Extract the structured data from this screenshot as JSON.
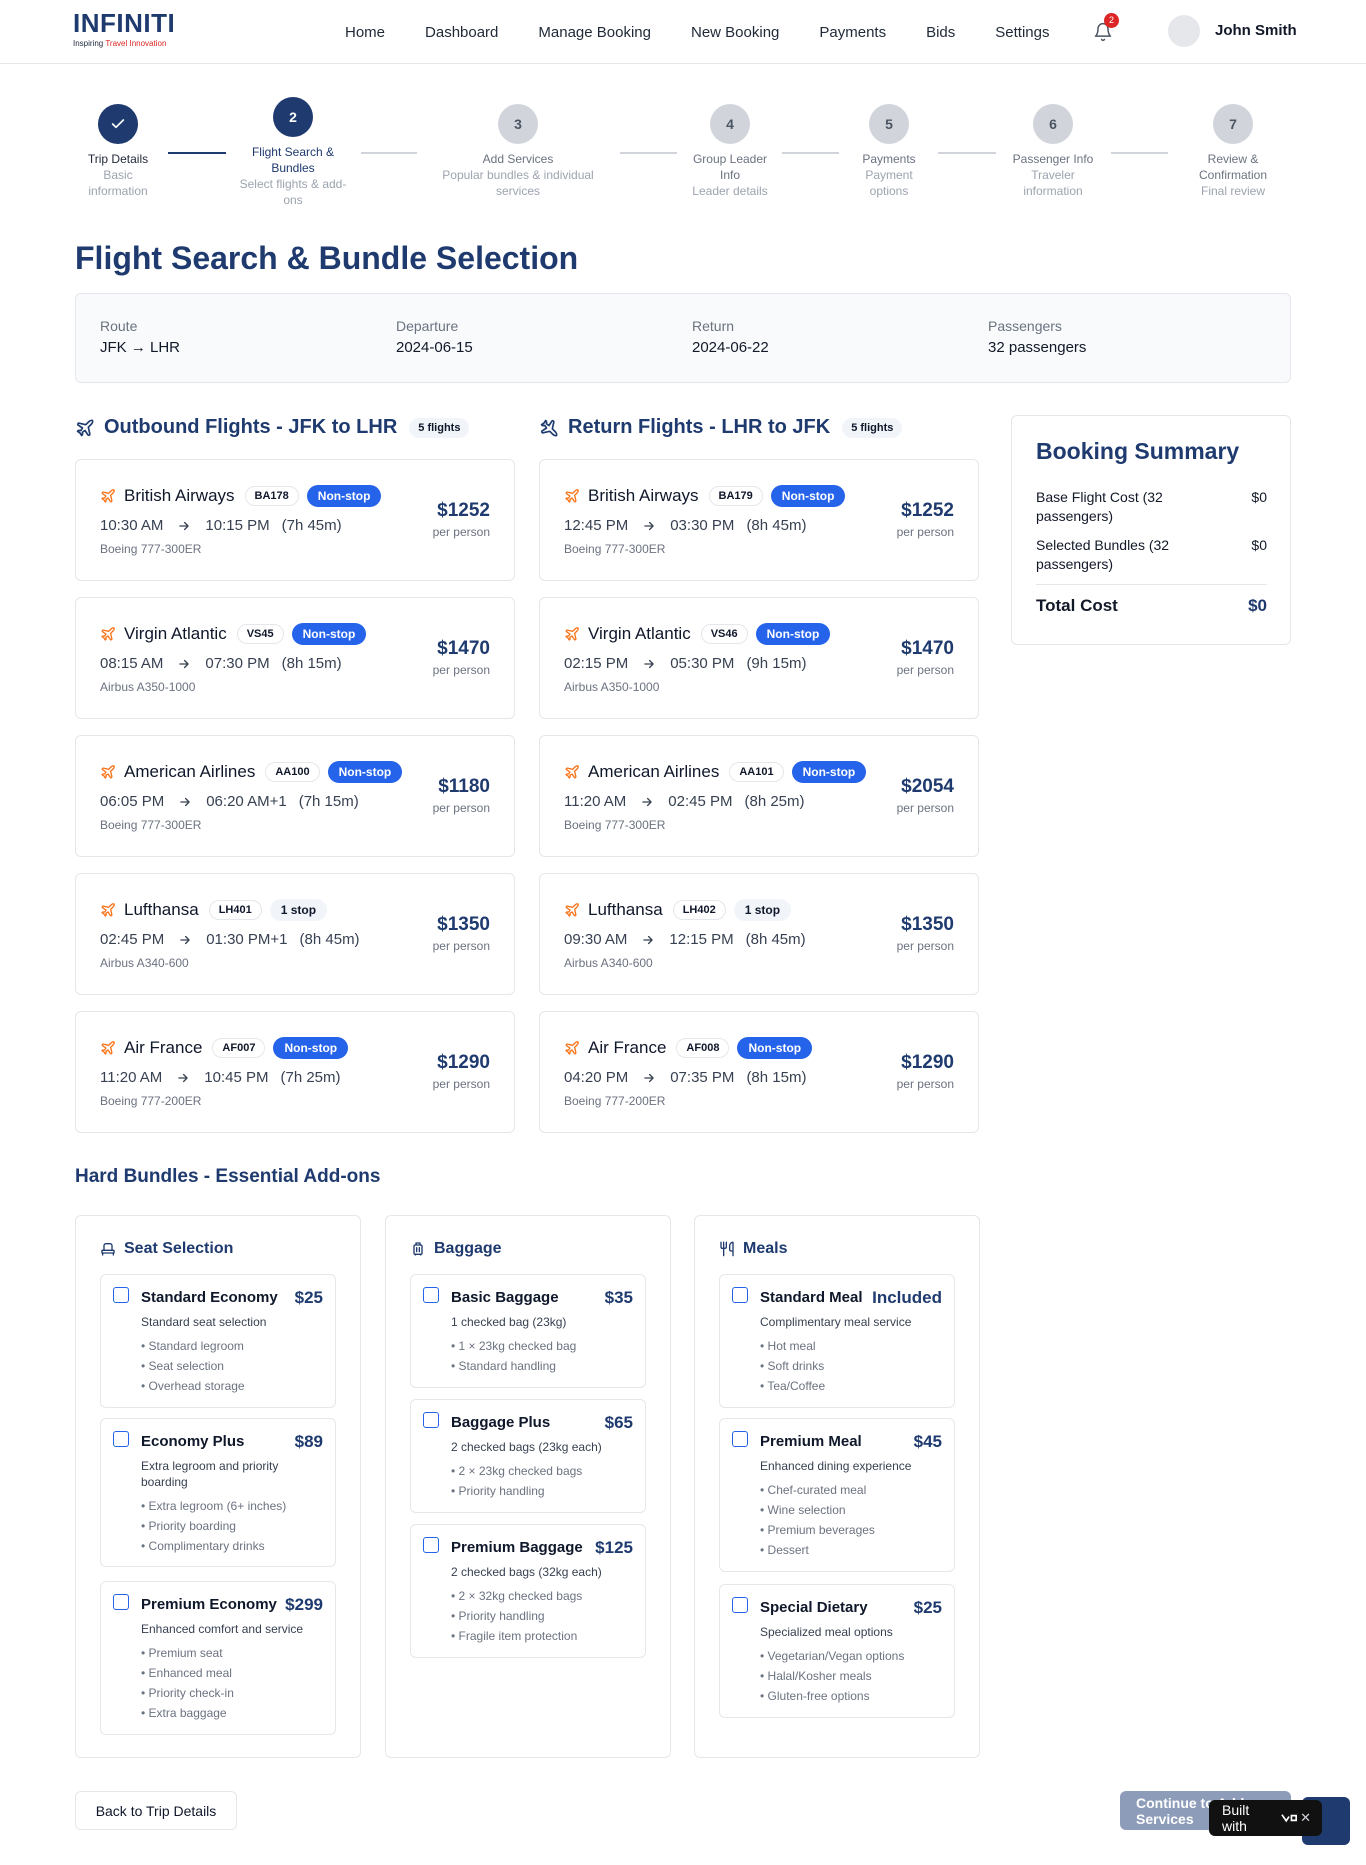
{
  "brand": {
    "name": "INFINITI",
    "tagline_start": "Inspiring ",
    "tagline_accent": "Travel Innovation"
  },
  "nav": {
    "links": [
      "Home",
      "Dashboard",
      "Manage Booking",
      "New Booking",
      "Payments",
      "Bids",
      "Settings"
    ],
    "notifications": "2",
    "user": "John Smith"
  },
  "steps": [
    {
      "num": "",
      "title": "Trip Details",
      "sub": "Basic information",
      "state": "done"
    },
    {
      "num": "2",
      "title": "Flight Search & Bundles",
      "sub": "Select flights & add-ons",
      "state": "active"
    },
    {
      "num": "3",
      "title": "Add Services",
      "sub": "Popular bundles & individual services",
      "state": "todo"
    },
    {
      "num": "4",
      "title": "Group Leader Info",
      "sub": "Leader details",
      "state": "todo"
    },
    {
      "num": "5",
      "title": "Payments",
      "sub": "Payment options",
      "state": "todo"
    },
    {
      "num": "6",
      "title": "Passenger Info",
      "sub": "Traveler information",
      "state": "todo"
    },
    {
      "num": "7",
      "title": "Review & Confirmation",
      "sub": "Final review",
      "state": "todo"
    }
  ],
  "page": {
    "title": "Flight Search & Bundle Selection"
  },
  "route": {
    "route_label": "Route",
    "route_value": "JFK → LHR",
    "departure_label": "Departure",
    "departure_value": "2024-06-15",
    "return_label": "Return",
    "return_value": "2024-06-22",
    "passengers_label": "Passengers",
    "passengers_value": "32 passengers"
  },
  "outbound": {
    "title": "Outbound Flights - JFK to LHR",
    "count": "5 flights",
    "flights": [
      {
        "airline": "British Airways",
        "code": "BA178",
        "type": "Non-stop",
        "dep": "10:30 AM",
        "arr": "10:15 PM",
        "dur": "(7h 45m)",
        "aircraft": "Boeing 777-300ER",
        "price": "$1252",
        "per": "per person"
      },
      {
        "airline": "Virgin Atlantic",
        "code": "VS45",
        "type": "Non-stop",
        "dep": "08:15 AM",
        "arr": "07:30 PM",
        "dur": "(8h 15m)",
        "aircraft": "Airbus A350-1000",
        "price": "$1470",
        "per": "per person"
      },
      {
        "airline": "American Airlines",
        "code": "AA100",
        "type": "Non-stop",
        "dep": "06:05 PM",
        "arr": "06:20 AM+1",
        "dur": "(7h 15m)",
        "aircraft": "Boeing 777-300ER",
        "price": "$1180",
        "per": "per person"
      },
      {
        "airline": "Lufthansa",
        "code": "LH401",
        "type": "1 stop",
        "dep": "02:45 PM",
        "arr": "01:30 PM+1",
        "dur": "(8h 45m)",
        "aircraft": "Airbus A340-600",
        "price": "$1350",
        "per": "per person"
      },
      {
        "airline": "Air France",
        "code": "AF007",
        "type": "Non-stop",
        "dep": "11:20 AM",
        "arr": "10:45 PM",
        "dur": "(7h 25m)",
        "aircraft": "Boeing 777-200ER",
        "price": "$1290",
        "per": "per person"
      }
    ]
  },
  "return": {
    "title": "Return Flights - LHR to JFK",
    "count": "5 flights",
    "flights": [
      {
        "airline": "British Airways",
        "code": "BA179",
        "type": "Non-stop",
        "dep": "12:45 PM",
        "arr": "03:30 PM",
        "dur": "(8h 45m)",
        "aircraft": "Boeing 777-300ER",
        "price": "$1252",
        "per": "per person"
      },
      {
        "airline": "Virgin Atlantic",
        "code": "VS46",
        "type": "Non-stop",
        "dep": "02:15 PM",
        "arr": "05:30 PM",
        "dur": "(9h 15m)",
        "aircraft": "Airbus A350-1000",
        "price": "$1470",
        "per": "per person"
      },
      {
        "airline": "American Airlines",
        "code": "AA101",
        "type": "Non-stop",
        "dep": "11:20 AM",
        "arr": "02:45 PM",
        "dur": "(8h 25m)",
        "aircraft": "Boeing 777-300ER",
        "price": "$2054",
        "per": "per person"
      },
      {
        "airline": "Lufthansa",
        "code": "LH402",
        "type": "1 stop",
        "dep": "09:30 AM",
        "arr": "12:15 PM",
        "dur": "(8h 45m)",
        "aircraft": "Airbus A340-600",
        "price": "$1350",
        "per": "per person"
      },
      {
        "airline": "Air France",
        "code": "AF008",
        "type": "Non-stop",
        "dep": "04:20 PM",
        "arr": "07:35 PM",
        "dur": "(8h 15m)",
        "aircraft": "Boeing 777-200ER",
        "price": "$1290",
        "per": "per person"
      }
    ]
  },
  "summary": {
    "title": "Booking Summary",
    "base_label": "Base Flight Cost (32 passengers)",
    "base_value": "$0",
    "bundles_label": "Selected Bundles (32 passengers)",
    "bundles_value": "$0",
    "total_label": "Total Cost",
    "total_value": "$0"
  },
  "bundles": {
    "title": "Hard Bundles - Essential Add-ons",
    "columns": [
      {
        "title": "Seat Selection",
        "icon": "seat-icon",
        "items": [
          {
            "name": "Standard Economy",
            "price": "$25",
            "desc": "Standard seat selection",
            "features": [
              "• Standard legroom",
              "• Seat selection",
              "• Overhead storage"
            ]
          },
          {
            "name": "Economy Plus",
            "price": "$89",
            "desc": "Extra legroom and priority boarding",
            "features": [
              "• Extra legroom (6+ inches)",
              "• Priority boarding",
              "• Complimentary drinks"
            ]
          },
          {
            "name": "Premium Economy",
            "price": "$299",
            "desc": "Enhanced comfort and service",
            "features": [
              "• Premium seat",
              "• Enhanced meal",
              "• Priority check-in",
              "• Extra baggage"
            ]
          }
        ]
      },
      {
        "title": "Baggage",
        "icon": "luggage-icon",
        "items": [
          {
            "name": "Basic Baggage",
            "price": "$35",
            "desc": "1 checked bag (23kg)",
            "features": [
              "• 1 × 23kg checked bag",
              "• Standard handling"
            ]
          },
          {
            "name": "Baggage Plus",
            "price": "$65",
            "desc": "2 checked bags (23kg each)",
            "features": [
              "• 2 × 23kg checked bags",
              "• Priority handling"
            ]
          },
          {
            "name": "Premium Baggage",
            "price": "$125",
            "desc": "2 checked bags (32kg each)",
            "features": [
              "• 2 × 32kg checked bags",
              "• Priority handling",
              "• Fragile item protection"
            ]
          }
        ]
      },
      {
        "title": "Meals",
        "icon": "utensils-icon",
        "items": [
          {
            "name": "Standard Meal",
            "price": "Included",
            "desc": "Complimentary meal service",
            "features": [
              "• Hot meal",
              "• Soft drinks",
              "• Tea/Coffee"
            ]
          },
          {
            "name": "Premium Meal",
            "price": "$45",
            "desc": "Enhanced dining experience",
            "features": [
              "• Chef-curated meal",
              "• Wine selection",
              "• Premium beverages",
              "• Dessert"
            ]
          },
          {
            "name": "Special Dietary",
            "price": "$25",
            "desc": "Specialized meal options",
            "features": [
              "• Vegetarian/Vegan options",
              "• Halal/Kosher meals",
              "• Gluten-free options"
            ]
          }
        ]
      }
    ]
  },
  "footer": {
    "back": "Back to Trip Details",
    "continue": "Continue to Add Services",
    "built_with": "Built with"
  },
  "colors": {
    "primary": "#1e3a6e",
    "accent_blue": "#2563eb",
    "plane_orange": "#f97316",
    "badge_red": "#dc2626"
  }
}
